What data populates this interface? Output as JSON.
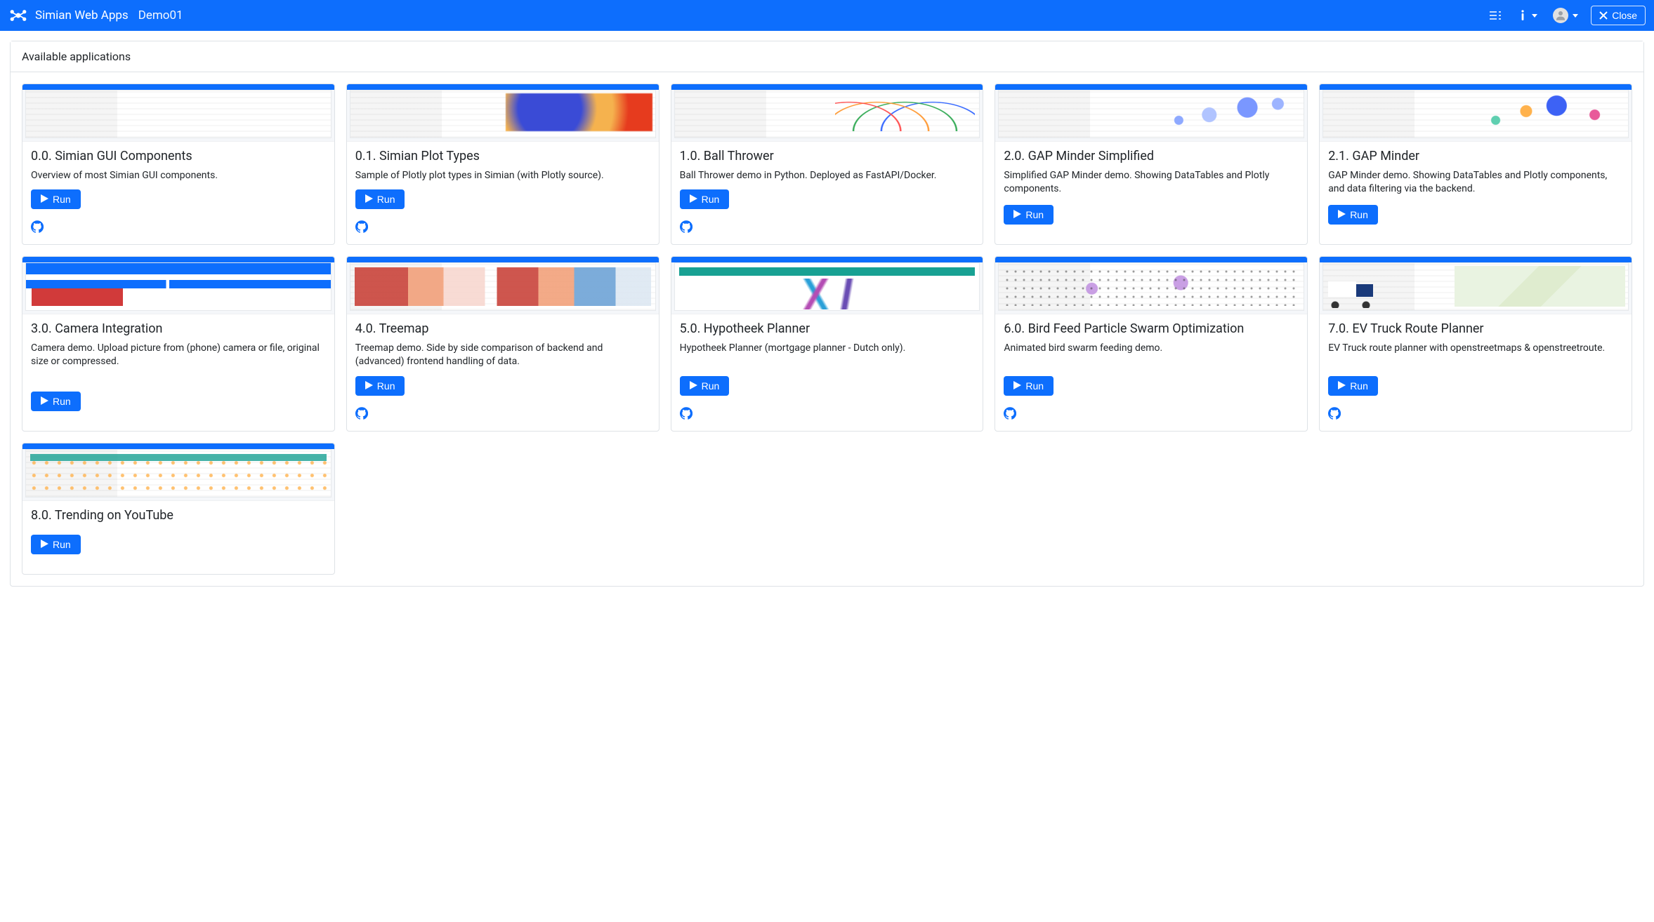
{
  "header": {
    "brand": "Simian Web Apps",
    "sub": "Demo01",
    "close_label": "Close"
  },
  "panel": {
    "title": "Available applications"
  },
  "run_label": "Run",
  "apps": [
    {
      "title": "0.0. Simian GUI Components",
      "desc": "Overview of most Simian GUI components.",
      "thumb": "plain",
      "github": true
    },
    {
      "title": "0.1. Simian Plot Types",
      "desc": "Sample of Plotly plot types in Simian (with Plotly source).",
      "thumb": "heat",
      "github": true
    },
    {
      "title": "1.0. Ball Thrower",
      "desc": "Ball Thrower demo in Python. Deployed as FastAPI/Docker.",
      "thumb": "lines",
      "github": true
    },
    {
      "title": "2.0. GAP Minder Simplified",
      "desc": "Simplified GAP Minder demo. Showing DataTables and Plotly components.",
      "thumb": "bubbles",
      "github": false
    },
    {
      "title": "2.1. GAP Minder",
      "desc": "GAP Minder demo. Showing DataTables and Plotly components, and data filtering via the backend.",
      "thumb": "bubbles2",
      "github": false
    },
    {
      "title": "3.0. Camera Integration",
      "desc": "Camera demo. Upload picture from (phone) camera or file, original size or compressed.",
      "thumb": "camera",
      "github": false
    },
    {
      "title": "4.0. Treemap",
      "desc": "Treemap demo. Side by side comparison of backend and (advanced) frontend handling of data.",
      "thumb": "treemap",
      "github": true
    },
    {
      "title": "5.0. Hypotheek Planner",
      "desc": "Hypotheek Planner (mortgage planner - Dutch only).",
      "thumb": "hypo",
      "github": true
    },
    {
      "title": "6.0. Bird Feed Particle Swarm Optimization",
      "desc": "Animated bird swarm feeding demo.",
      "thumb": "bird",
      "github": true
    },
    {
      "title": "7.0. EV Truck Route Planner",
      "desc": "EV Truck route planner with openstreetmaps & openstreetroute.",
      "thumb": "map",
      "github": true
    },
    {
      "title": "8.0. Trending on YouTube",
      "desc": "",
      "thumb": "yt",
      "github": false
    }
  ]
}
